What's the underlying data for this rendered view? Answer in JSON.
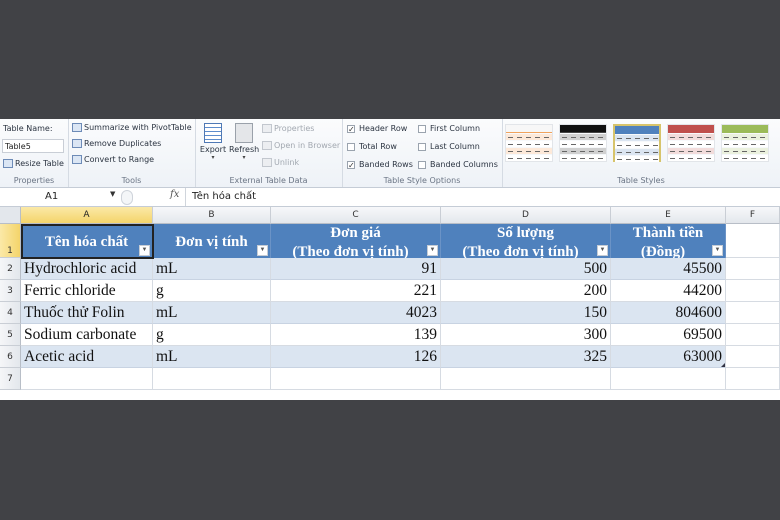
{
  "ribbon": {
    "properties": {
      "table_name_label": "Table Name:",
      "table_name_value": "Table5",
      "resize_table": "Resize Table",
      "group_label": "Properties"
    },
    "tools": {
      "summarize_pivot": "Summarize with PivotTable",
      "remove_duplicates": "Remove Duplicates",
      "convert_to_range": "Convert to Range",
      "group_label": "Tools"
    },
    "external": {
      "export": "Export",
      "refresh": "Refresh",
      "properties": "Properties",
      "open_in_browser": "Open in Browser",
      "unlink": "Unlink",
      "group_label": "External Table Data"
    },
    "style_options": {
      "header_row": {
        "label": "Header Row",
        "checked": true
      },
      "total_row": {
        "label": "Total Row",
        "checked": false
      },
      "banded_rows": {
        "label": "Banded Rows",
        "checked": true
      },
      "first_column": {
        "label": "First Column",
        "checked": false
      },
      "last_column": {
        "label": "Last Column",
        "checked": false
      },
      "banded_columns": {
        "label": "Banded Columns",
        "checked": false
      },
      "group_label": "Table Style Options"
    },
    "table_styles": {
      "group_label": "Table Styles",
      "swatches": [
        {
          "name": "orange-light",
          "header": "#f7f7f7",
          "line": "#f1a35c",
          "band": "#fde9d9"
        },
        {
          "name": "black-medium",
          "header": "#111111",
          "line": "#444444",
          "band": "#d0d0d0"
        },
        {
          "name": "blue-medium",
          "header": "#4f81bd",
          "line": "#4f81bd",
          "band": "#dbe5f1",
          "selected": true
        },
        {
          "name": "red-medium",
          "header": "#c0504d",
          "line": "#c0504d",
          "band": "#f2dcdb"
        },
        {
          "name": "green-medium",
          "header": "#9bbb59",
          "line": "#9bbb59",
          "band": "#ebf1de"
        }
      ]
    }
  },
  "formula_bar": {
    "name_box": "A1",
    "fx": "fx",
    "content": "Tên hóa chất"
  },
  "sheet": {
    "columns": [
      "A",
      "B",
      "C",
      "D",
      "E",
      "F"
    ],
    "selected_column": "A",
    "row_numbers": [
      "1",
      "2",
      "3",
      "4",
      "5",
      "6",
      "7"
    ],
    "header_color": "#4f81bd",
    "band_color": "#dbe5f1",
    "headers": [
      {
        "line1": "Tên hóa chất",
        "line2": ""
      },
      {
        "line1": "Đơn vị tính",
        "line2": ""
      },
      {
        "line1": "Đơn giá",
        "line2": "(Theo đơn vị tính)"
      },
      {
        "line1": "Số lượng",
        "line2": "(Theo đơn vị tính)"
      },
      {
        "line1": "Thành tiền",
        "line2": "(Đồng)"
      }
    ],
    "rows": [
      [
        "Hydrochloric acid",
        "mL",
        "91",
        "500",
        "45500"
      ],
      [
        "Ferric chloride",
        "g",
        "221",
        "200",
        "44200"
      ],
      [
        "Thuốc thử Folin",
        "mL",
        "4023",
        "150",
        "804600"
      ],
      [
        "Sodium carbonate",
        "g",
        "139",
        "300",
        "69500"
      ],
      [
        "Acetic acid",
        "mL",
        "126",
        "325",
        "63000"
      ]
    ]
  }
}
